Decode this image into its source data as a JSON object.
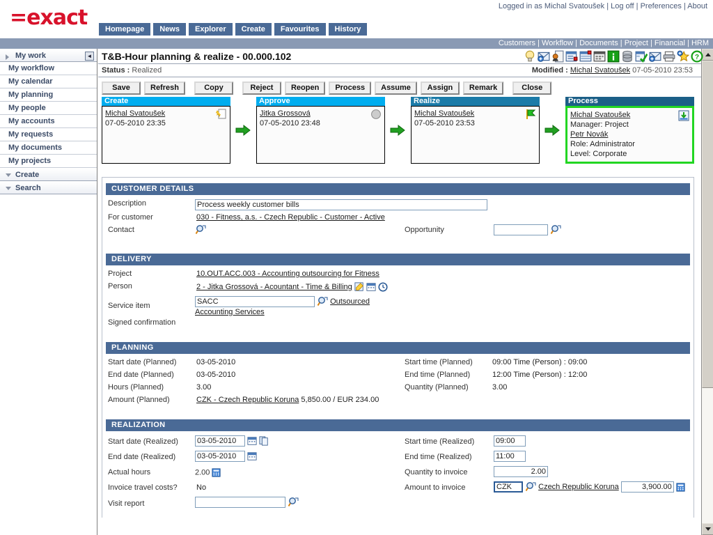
{
  "header": {
    "logo_eq": "=",
    "logo_text": "exact",
    "login_prefix": "Logged in as",
    "user": "Michal Svatoušek",
    "links": [
      "Log off",
      "Preferences",
      "About"
    ],
    "nav_tabs": [
      "Homepage",
      "News",
      "Explorer",
      "Create",
      "Favourites",
      "History"
    ],
    "modules": [
      "Customers",
      "Workflow",
      "Documents",
      "Project",
      "Financial",
      "HRM"
    ]
  },
  "sidebar": {
    "collapse_label": "◄",
    "groups": [
      {
        "label": "My work",
        "state": "right",
        "items": [
          "My workflow",
          "My calendar",
          "My planning",
          "My people",
          "My accounts",
          "My requests",
          "My documents",
          "My projects"
        ]
      },
      {
        "label": "Create",
        "state": "down",
        "items": []
      },
      {
        "label": "Search",
        "state": "down",
        "items": []
      }
    ]
  },
  "document": {
    "title": "T&B-Hour planning & realize - 00.000.102",
    "status_label": "Status :",
    "status_value": "Realized",
    "modified_label": "Modified :",
    "modified_user": "Michal Svatoušek",
    "modified_time": "07-05-2010 23:53"
  },
  "iconbar": [
    "lightbulb-icon",
    "new-mail-icon",
    "contact-document-icon",
    "notes-icon",
    "list-icon",
    "calendar-grid-icon",
    "info-icon",
    "database-icon",
    "checklist-icon",
    "send-mail-icon",
    "print-icon",
    "add-favourite-icon",
    "help-icon"
  ],
  "buttons": [
    "Save",
    "Refresh",
    "Copy",
    "Reject",
    "Reopen",
    "Process",
    "Assume",
    "Assign",
    "Remark",
    "Close"
  ],
  "workflow": [
    {
      "title": "Create",
      "header_color": "#00adef",
      "person": "Michal Svatoušek",
      "timestamp": "07-05-2010 23:35",
      "icon": "new-document-icon",
      "active": false,
      "extra": []
    },
    {
      "title": "Approve",
      "header_color": "#00adef",
      "person": "Jitka Grossová",
      "timestamp": "07-05-2010 23:48",
      "icon": "grey-circle-icon",
      "active": false,
      "extra": []
    },
    {
      "title": "Realize",
      "header_color": "#1b7ba8",
      "person": "Michal Svatoušek",
      "timestamp": "07-05-2010 23:53",
      "icon": "green-flag-icon",
      "active": false,
      "extra": []
    },
    {
      "title": "Process",
      "header_color": "#1b5f87",
      "person": "Michal Svatoušek",
      "timestamp": "",
      "icon": "inbox-down-icon",
      "active": true,
      "extra": [
        "Manager: Project",
        "Petr Novák",
        "Role: Administrator",
        "Level: Corporate"
      ]
    }
  ],
  "sections": {
    "customer_details": {
      "title": "CUSTOMER DETAILS",
      "description_label": "Description",
      "description_value": "Process weekly customer bills",
      "for_customer_label": "For customer",
      "for_customer_value": "030 - Fitness, a.s. - Czech Republic - Customer - Active",
      "contact_label": "Contact",
      "contact_icon": "lookup-icon",
      "opportunity_label": "Opportunity",
      "opportunity_value": "",
      "opportunity_icon": "lookup-icon"
    },
    "delivery": {
      "title": "DELIVERY",
      "project_label": "Project",
      "project_value": "10.OUT.ACC.003 - Accounting outsourcing for Fitness",
      "person_label": "Person",
      "person_value": "2 - Jitka Grossová - Acountant - Time & Billing",
      "person_icons": [
        "edit-icon",
        "calendar-icon",
        "clock-icon"
      ],
      "service_item_label": "Service item",
      "service_item_value": "SACC",
      "service_item_icon": "lookup-icon",
      "service_item_link1": "Outsourced",
      "service_item_link2": "Accounting Services",
      "signed_confirmation_label": "Signed confirmation"
    },
    "planning": {
      "title": "PLANNING",
      "rows_left": [
        {
          "label": "Start date (Planned)",
          "value": "03-05-2010"
        },
        {
          "label": "End date (Planned)",
          "value": "03-05-2010"
        },
        {
          "label": "Hours (Planned)",
          "value": "3.00"
        }
      ],
      "amount_label": "Amount (Planned)",
      "amount_currency": "CZK - Czech Republic Koruna",
      "amount_value": "5,850.00 / EUR 234.00",
      "rows_right": [
        {
          "label": "Start time (Planned)",
          "value": "09:00 Time (Person) : 09:00"
        },
        {
          "label": "End time (Planned)",
          "value": "12:00 Time (Person) : 12:00"
        },
        {
          "label": "Quantity (Planned)",
          "value": "3.00"
        }
      ]
    },
    "realization": {
      "title": "REALIZATION",
      "start_date_label": "Start date (Realized)",
      "start_date_value": "03-05-2010",
      "end_date_label": "End date (Realized)",
      "end_date_value": "03-05-2010",
      "actual_hours_label": "Actual hours",
      "actual_hours_value": "2.00",
      "invoice_travel_label": "Invoice travel costs?",
      "invoice_travel_value": "No",
      "visit_report_label": "Visit report",
      "visit_report_value": "",
      "start_time_label": "Start time (Realized)",
      "start_time_value": "09:00",
      "end_time_label": "End time (Realized)",
      "end_time_value": "11:00",
      "quantity_label": "Quantity to invoice",
      "quantity_value": "2.00",
      "amount_label": "Amount to invoice",
      "amount_currency_code": "CZK",
      "amount_currency_name": "Czech Republic Koruna",
      "amount_value": "3,900.00"
    }
  },
  "colors": {
    "brand_red": "#d8122b",
    "nav_blue": "#4a6a96",
    "module_bar": "#8a9ab4",
    "section_header": "#4a6a96",
    "active_outline": "#22d622"
  }
}
